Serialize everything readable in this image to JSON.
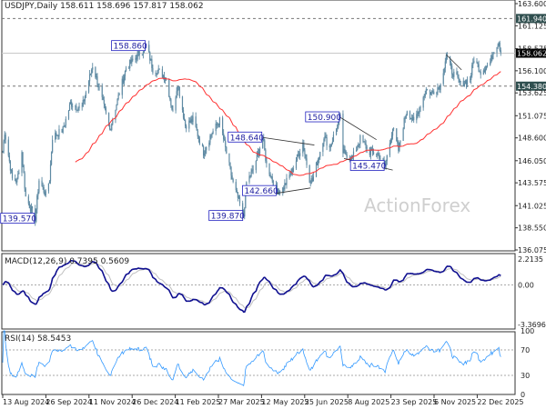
{
  "header": {
    "symbol_line": "USDJPY,Daily  158.611 158.696 157.817 158.062"
  },
  "watermark": "ActionForex",
  "chart_data": [
    {
      "type": "candlestick",
      "title": "USDJPY,Daily",
      "ohlc_last": {
        "open": 158.611,
        "high": 158.696,
        "low": 157.817,
        "close": 158.062
      },
      "ylim": [
        136.075,
        163.6
      ],
      "y_ticks": [
        "163.600",
        "161.125",
        "158.575",
        "156.100",
        "153.625",
        "151.075",
        "148.600",
        "146.050",
        "143.575",
        "141.025",
        "138.550",
        "136.075"
      ],
      "x_ticks": [
        "13 Aug 2024",
        "26 Sep 2024",
        "11 Nov 2024",
        "26 Dec 2024",
        "11 Feb 2025",
        "27 Mar 2025",
        "12 May 2025",
        "25 Jun 2025",
        "8 Aug 2025",
        "23 Sep 2025",
        "6 Nov 2025",
        "22 Dec 2025"
      ],
      "close_path": [
        [
          "2024-08-13",
          147.0
        ],
        [
          "2024-08-15",
          149.3
        ],
        [
          "2024-08-23",
          144.0
        ],
        [
          "2024-08-28",
          143.8
        ],
        [
          "2024-09-02",
          147.0
        ],
        [
          "2024-09-06",
          142.0
        ],
        [
          "2024-09-16",
          139.57
        ],
        [
          "2024-09-20",
          143.9
        ],
        [
          "2024-09-27",
          142.2
        ],
        [
          "2024-10-01",
          144.0
        ],
        [
          "2024-10-04",
          148.7
        ],
        [
          "2024-10-15",
          149.5
        ],
        [
          "2024-10-23",
          152.5
        ],
        [
          "2024-10-31",
          152.0
        ],
        [
          "2024-11-04",
          152.0
        ],
        [
          "2024-11-15",
          156.7
        ],
        [
          "2024-11-21",
          154.5
        ],
        [
          "2024-12-03",
          149.5
        ],
        [
          "2024-12-13",
          153.6
        ],
        [
          "2024-12-20",
          156.4
        ],
        [
          "2025-01-10",
          158.86
        ],
        [
          "2025-01-14",
          157.5
        ],
        [
          "2025-01-17",
          156.3
        ],
        [
          "2025-01-24",
          156.0
        ],
        [
          "2025-01-31",
          155.2
        ],
        [
          "2025-02-07",
          151.4
        ],
        [
          "2025-02-12",
          154.8
        ],
        [
          "2025-02-20",
          150.0
        ],
        [
          "2025-02-28",
          150.6
        ],
        [
          "2025-03-11",
          147.0
        ],
        [
          "2025-03-19",
          149.0
        ],
        [
          "2025-03-28",
          150.5
        ],
        [
          "2025-04-04",
          146.9
        ],
        [
          "2025-04-11",
          143.5
        ],
        [
          "2025-04-22",
          139.87
        ],
        [
          "2025-04-25",
          143.6
        ],
        [
          "2025-05-02",
          145.0
        ],
        [
          "2025-05-12",
          148.64
        ],
        [
          "2025-05-16",
          145.6
        ],
        [
          "2025-05-27",
          142.66
        ],
        [
          "2025-06-02",
          142.9
        ],
        [
          "2025-06-11",
          144.8
        ],
        [
          "2025-06-23",
          148.0
        ],
        [
          "2025-06-30",
          144.0
        ],
        [
          "2025-07-03",
          143.8
        ],
        [
          "2025-07-15",
          148.8
        ],
        [
          "2025-07-21",
          147.5
        ],
        [
          "2025-08-01",
          150.9
        ],
        [
          "2025-08-04",
          147.0
        ],
        [
          "2025-08-14",
          146.4
        ],
        [
          "2025-08-22",
          148.5
        ],
        [
          "2025-09-01",
          147.0
        ],
        [
          "2025-09-10",
          146.8
        ],
        [
          "2025-09-17",
          145.47
        ],
        [
          "2025-09-25",
          149.7
        ],
        [
          "2025-10-01",
          147.2
        ],
        [
          "2025-10-06",
          150.0
        ],
        [
          "2025-10-10",
          151.8
        ],
        [
          "2025-10-17",
          150.3
        ],
        [
          "2025-10-30",
          154.0
        ],
        [
          "2025-11-04",
          153.6
        ],
        [
          "2025-11-14",
          154.5
        ],
        [
          "2025-11-20",
          157.89
        ],
        [
          "2025-11-26",
          156.0
        ],
        [
          "2025-12-05",
          154.6
        ],
        [
          "2025-12-15",
          155.2
        ],
        [
          "2025-12-19",
          157.5
        ],
        [
          "2025-12-26",
          156.0
        ],
        [
          "2026-01-05",
          157.0
        ],
        [
          "2026-01-09",
          158.5
        ],
        [
          "2026-01-14",
          159.4
        ],
        [
          "2026-01-16",
          158.062
        ]
      ],
      "moving_average_color": "#ff3030",
      "candle_color": "#5e8aa3",
      "horizontal_levels": [
        {
          "value": "161.940",
          "style": "dashed"
        },
        {
          "value": "154.380",
          "style": "dashed"
        },
        {
          "value": "158.062",
          "style": "solid",
          "current": true
        }
      ],
      "annotations": [
        {
          "text": "158.860",
          "date": "2025-01-10",
          "price": 158.86,
          "side": "left"
        },
        {
          "text": "139.570",
          "date": "2024-09-16",
          "price": 139.57,
          "side": "left"
        },
        {
          "text": "139.870",
          "date": "2025-04-22",
          "price": 139.87,
          "side": "left"
        },
        {
          "text": "148.640",
          "date": "2025-05-12",
          "price": 148.64,
          "side": "left"
        },
        {
          "text": "142.660",
          "date": "2025-05-27",
          "price": 142.66,
          "side": "left"
        },
        {
          "text": "150.900",
          "date": "2025-08-01",
          "price": 150.9,
          "side": "left"
        },
        {
          "text": "145.470",
          "date": "2025-09-17",
          "price": 145.47,
          "side": "left"
        }
      ],
      "trendlines": [
        [
          [
            "2025-05-12",
            148.64
          ],
          [
            "2025-07-05",
            147.8
          ]
        ],
        [
          [
            "2025-05-14",
            142.2
          ],
          [
            "2025-07-01",
            143.0
          ]
        ],
        [
          [
            "2025-08-01",
            150.9
          ],
          [
            "2025-09-08",
            148.4
          ]
        ],
        [
          [
            "2025-08-05",
            146.3
          ],
          [
            "2025-09-25",
            145.0
          ]
        ],
        [
          [
            "2025-11-20",
            157.9
          ],
          [
            "2025-12-06",
            156.2
          ]
        ]
      ]
    },
    {
      "type": "line",
      "title": "MACD(12,26,9) 0.7395 0.5609",
      "ylim": [
        -3.3696,
        2.2135
      ],
      "y_ticks": [
        "2.2135",
        "0.00",
        "-3.3696"
      ],
      "series": [
        {
          "name": "MACD",
          "color": "#101090"
        },
        {
          "name": "Signal",
          "color": "#c0c0c0"
        }
      ]
    },
    {
      "type": "line",
      "title": "RSI(14) 58.5453",
      "ylim": [
        0,
        100
      ],
      "y_ticks": [
        "100",
        "70",
        "30",
        "0"
      ],
      "levels": [
        70,
        30
      ],
      "series": [
        {
          "name": "RSI",
          "color": "#3399ff"
        }
      ]
    }
  ]
}
